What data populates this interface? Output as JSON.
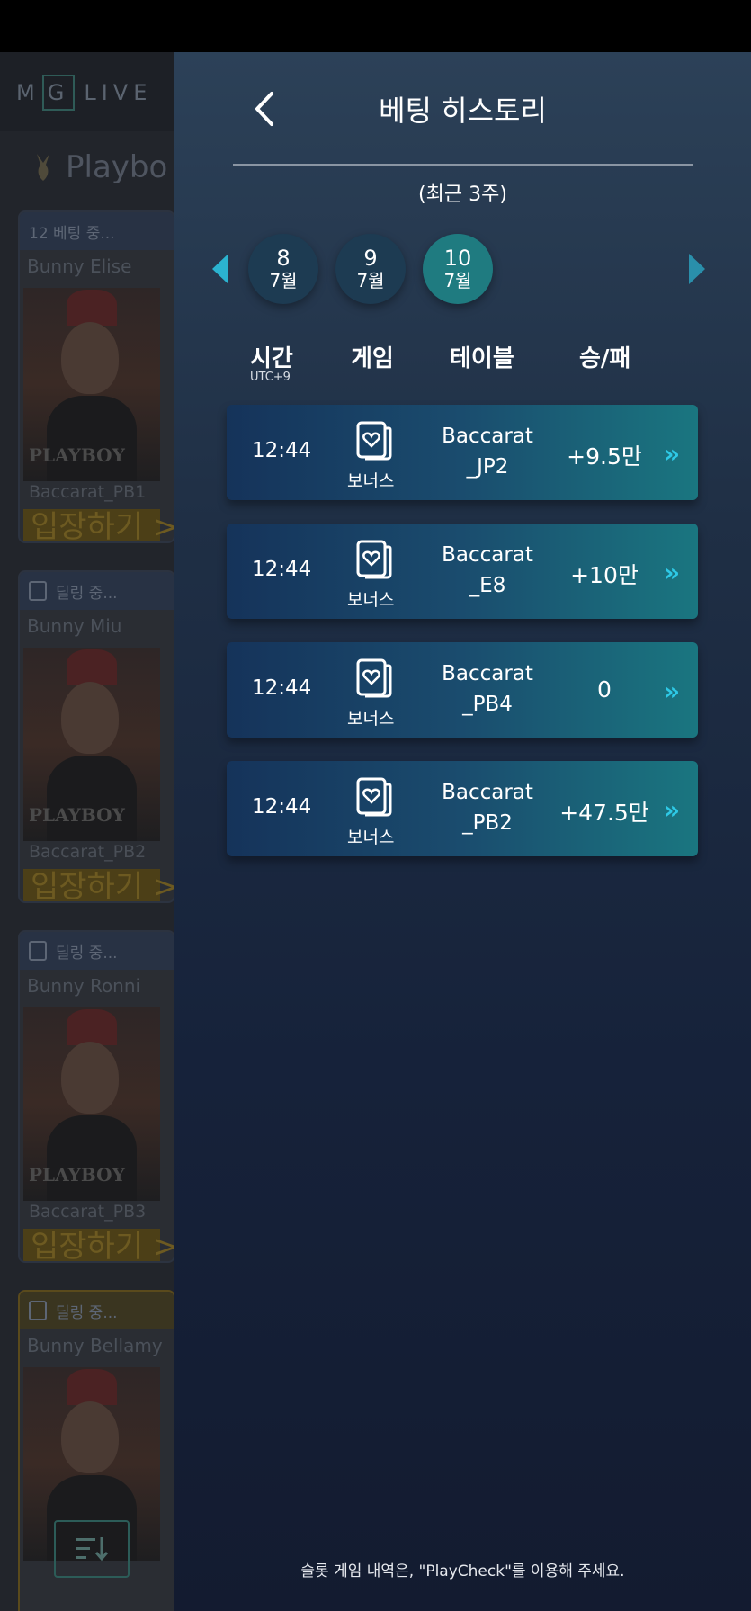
{
  "background_app": {
    "logo_m": "M",
    "logo_g": "G",
    "logo_live": "LIVE",
    "title": "Playbo",
    "cards": [
      {
        "status": "12  베팅 중...",
        "dealer": "Bunny Elise",
        "brand": "PLAYBOY",
        "table": "Baccarat_PB1",
        "enter": "입장하기 >>"
      },
      {
        "status": "딜링 중...",
        "dealer": "Bunny Miu",
        "brand": "PLAYBOY",
        "table": "Baccarat_PB2",
        "enter": "입장하기 >>"
      },
      {
        "status": "딜링 중...",
        "dealer": "Bunny Ronni",
        "brand": "PLAYBOY",
        "table": "Baccarat_PB3",
        "enter": "입장하기 >>"
      },
      {
        "status": "딜링 중...",
        "dealer": "Bunny Bellamy",
        "brand": "",
        "table": "",
        "enter": ""
      }
    ],
    "sort_icon": "sort-icon"
  },
  "panel": {
    "title": "베팅 히스토리",
    "period": "(최근 3주)",
    "dates": [
      {
        "day": "8",
        "month": "7월",
        "active": false
      },
      {
        "day": "9",
        "month": "7월",
        "active": false
      },
      {
        "day": "10",
        "month": "7월",
        "active": true
      }
    ],
    "headers": {
      "time": "시간",
      "time_sub": "UTC+9",
      "game": "게임",
      "table": "테이블",
      "result": "승/패"
    },
    "rows": [
      {
        "time": "12:44",
        "game": "보너스",
        "table_line1": "Baccarat",
        "table_line2": "_JP2",
        "result": "+9.5만"
      },
      {
        "time": "12:44",
        "game": "보너스",
        "table_line1": "Baccarat",
        "table_line2": "_E8",
        "result": "+10만"
      },
      {
        "time": "12:44",
        "game": "보너스",
        "table_line1": "Baccarat",
        "table_line2": "_PB4",
        "result": "0"
      },
      {
        "time": "12:44",
        "game": "보너스",
        "table_line1": "Baccarat",
        "table_line2": "_PB2",
        "result": "+47.5만"
      }
    ],
    "row_chevron": "»",
    "footer": "슬롯 게임 내역은, \"PlayCheck\"를 이용해 주세요."
  },
  "colors": {
    "accent": "#2bb3d0",
    "active_date": "#1f7b80",
    "inactive_date": "#1d3b52"
  }
}
